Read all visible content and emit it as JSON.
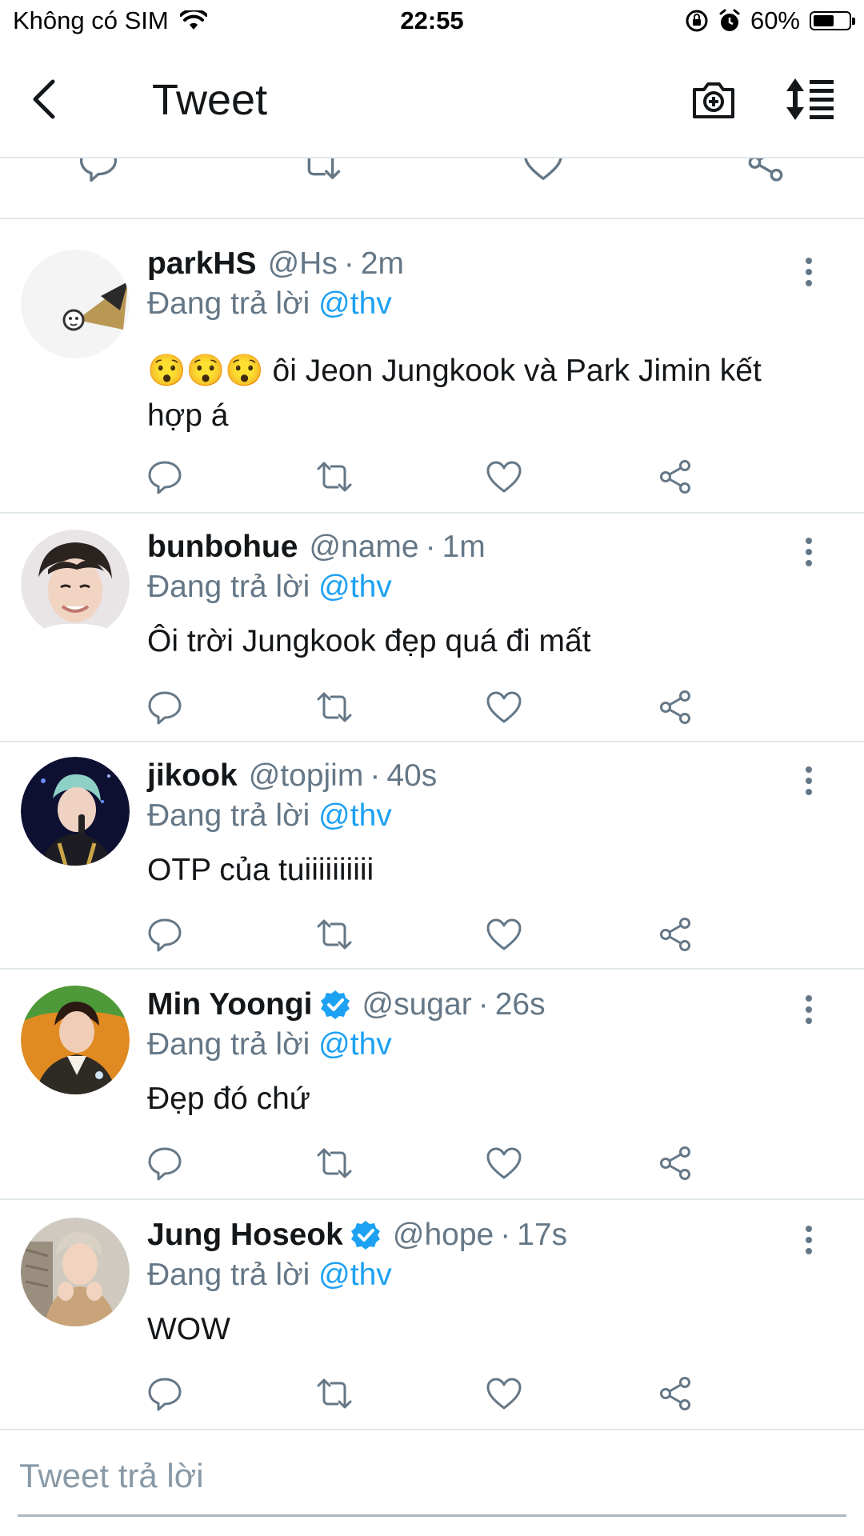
{
  "status_bar": {
    "carrier": "Không có SIM",
    "time": "22:55",
    "battery_text": "60%",
    "battery_level": 0.6,
    "icons": [
      "wifi-icon",
      "rotation-lock-icon",
      "alarm-icon",
      "battery-icon"
    ]
  },
  "nav": {
    "title": "Tweet",
    "icons": [
      "back-arrow-icon",
      "camera-plus-icon",
      "sort-icon"
    ]
  },
  "colors": {
    "accent": "#1da1f2",
    "text": "#14171a",
    "secondary": "#657786",
    "divider": "#e1e8ed",
    "icon_gray": "#657786"
  },
  "replies": [
    {
      "name": "parkHS",
      "verified": false,
      "handle": "@Hs",
      "separator": "·",
      "time": "2m",
      "replying_prefix": "Đang trả lời",
      "replying_to": "@thv",
      "text_line1": "😯😯😯 ôi Jeon Jungkook và Park Jimin kết",
      "text_line2": "hợp á"
    },
    {
      "name": "bunbohue",
      "verified": false,
      "handle": "@name",
      "separator": "·",
      "time": "1m",
      "replying_prefix": "Đang trả lời",
      "replying_to": "@thv",
      "text_line1": "Ôi trời Jungkook đẹp quá đi mất"
    },
    {
      "name": "jikook",
      "verified": false,
      "handle": "@topjim",
      "separator": "·",
      "time": "40s",
      "replying_prefix": "Đang trả lời",
      "replying_to": "@thv",
      "text_line1": "OTP của tuiiiiiiiiii"
    },
    {
      "name": "Min Yoongi",
      "verified": true,
      "handle": "@sugar",
      "separator": "·",
      "time": "26s",
      "replying_prefix": "Đang trả lời",
      "replying_to": "@thv",
      "text_line1": "Đẹp đó chứ"
    },
    {
      "name": "Jung Hoseok",
      "verified": true,
      "handle": "@hope",
      "separator": "·",
      "time": "17s",
      "replying_prefix": "Đang trả lời",
      "replying_to": "@thv",
      "text_line1": "WOW"
    }
  ],
  "action_icons": [
    "reply-icon",
    "retweet-icon",
    "like-icon",
    "share-icon"
  ],
  "reply_box": {
    "placeholder": "Tweet trả lời"
  }
}
